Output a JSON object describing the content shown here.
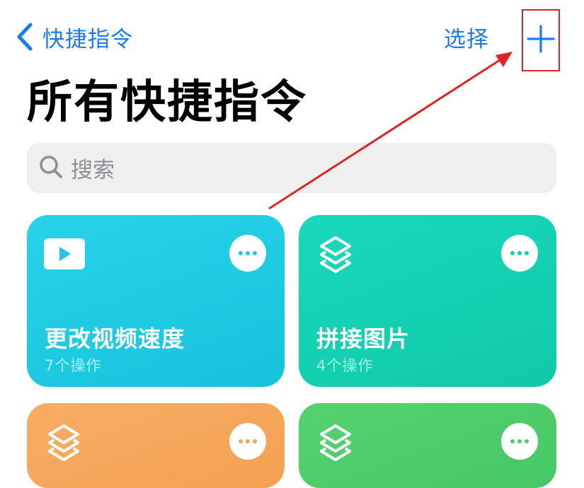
{
  "nav": {
    "back_label": "快捷指令",
    "select_label": "选择",
    "add_icon": "plus-icon",
    "back_icon": "chevron-left-icon"
  },
  "page_title": "所有快捷指令",
  "search": {
    "placeholder": "搜索",
    "icon": "search-icon"
  },
  "shortcuts": [
    {
      "title": "更改视频速度",
      "subtitle": "7个操作",
      "icon": "play-icon",
      "color": "#1ecbe1"
    },
    {
      "title": "拼接图片",
      "subtitle": "4个操作",
      "icon": "layers-icon",
      "color": "#12d1b2"
    },
    {
      "title": "",
      "subtitle": "",
      "icon": "layers-icon",
      "color": "#f6a75b"
    },
    {
      "title": "",
      "subtitle": "",
      "icon": "layers-icon",
      "color": "#4ccd6a"
    }
  ],
  "colors": {
    "accent": "#1a7cf5",
    "annotation_red": "#e02424",
    "search_bg": "#efeff0"
  }
}
